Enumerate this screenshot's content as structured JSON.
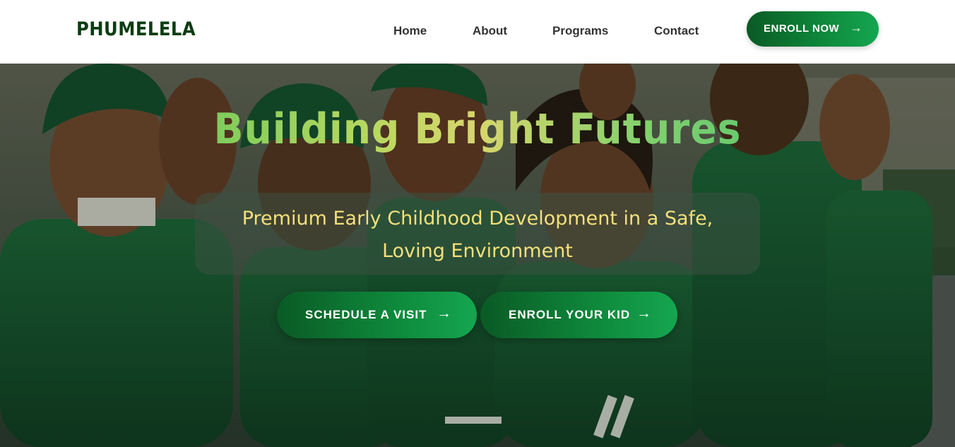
{
  "header": {
    "logo": "PHUMELELA",
    "nav": [
      "Home",
      "About",
      "Programs",
      "Contact"
    ],
    "cta_label": "ENROLL NOW",
    "cta_icon": "arrow-right-icon",
    "brand_color": "#0b3d12",
    "accent_color": "#0f8a3c"
  },
  "hero": {
    "image": "children-in-green-school-uniforms-photo",
    "title": "Building Bright Futures",
    "subtitle_line1": "Premium Early Childhood Development in a Safe,",
    "subtitle_line2": "Loving Environment",
    "subtitle_color": "#f3e07a",
    "buttons": [
      {
        "label": "SCHEDULE A VISIT",
        "icon": "arrow-right-icon"
      },
      {
        "label": "ENROLL YOUR KID",
        "icon": "arrow-right-icon"
      }
    ]
  }
}
